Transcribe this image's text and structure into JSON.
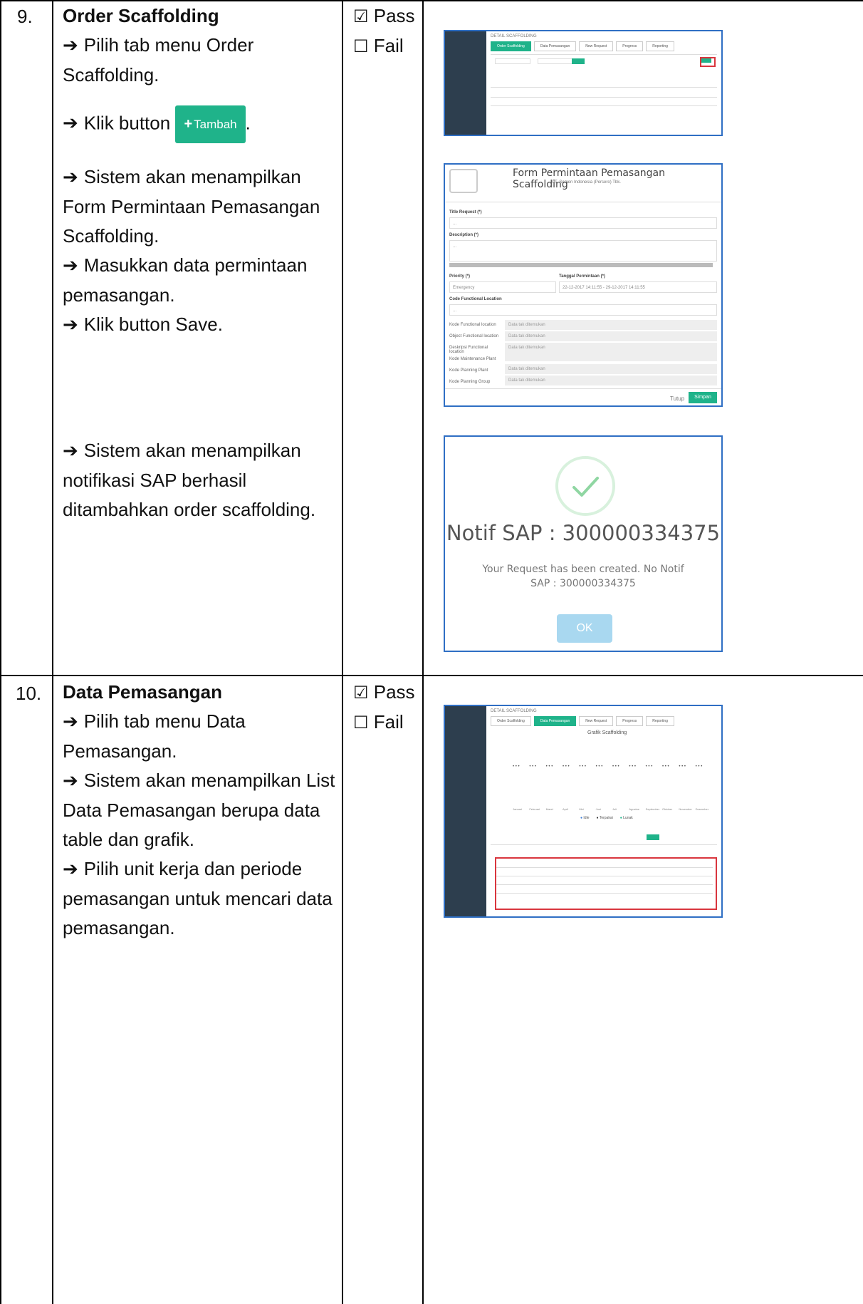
{
  "rows": [
    {
      "number": "9.",
      "title": "Order Scaffolding",
      "steps_a": [
        "Pilih tab menu Order Scaffolding.",
        "Klik button"
      ],
      "tambah_label": "Tambah",
      "steps_b": [
        "Sistem akan menampilkan Form Permintaan Pemasangan Scaffolding.",
        "Masukkan data permintaan pemasangan.",
        "Klik button Save."
      ],
      "steps_c": [
        "Sistem akan menampilkan notifikasi SAP berhasil ditambahkan order scaffolding."
      ],
      "pass_label": "Pass",
      "fail_label": "Fail"
    },
    {
      "number": "10.",
      "title": "Data Pemasangan",
      "steps": [
        "Pilih tab menu Data Pemasangan.",
        "Sistem akan menampilkan List Data Pemasangan berupa data table dan grafik.",
        "Pilih unit kerja dan periode pemasangan untuk mencari data pemasangan."
      ],
      "pass_label": "Pass",
      "fail_label": "Fail"
    }
  ],
  "shot1": {
    "header": "DETAIL SCAFFOLDING",
    "tabs": [
      "Order Scaffolding",
      "Data Pemasangan",
      "New Request",
      "Progress",
      "Reporting"
    ]
  },
  "shot2": {
    "title": "Form Permintaan Pemasangan Scaffolding",
    "subtitle": "PT. Semen Indonesia (Persero) Tbk.",
    "title_request_label": "Title Request (*)",
    "description_label": "Description (*)",
    "priority_label": "Priority (*)",
    "priority_value": "Emergency",
    "tanggal_label": "Tanggal Permintaan (*)",
    "tanggal_value": "22-12-2017 14:11:55 - 29-12-2017 14:11:55",
    "code_label": "Code Functional Location",
    "placeholder": "...",
    "info_rows": [
      {
        "label": "Kode Functional location",
        "value": "Data tak ditemukan"
      },
      {
        "label": "Object Functional location",
        "value": "Data tak ditemukan"
      },
      {
        "label": "Deskripsi Functional location",
        "value": "Data tak ditemukan"
      },
      {
        "label": "Kode Maintenance Plant",
        "value": ""
      },
      {
        "label": "Kode Planning Plant",
        "value": "Data tak ditemukan"
      },
      {
        "label": "Kode Planning Group",
        "value": "Data tak ditemukan"
      }
    ],
    "tutup": "Tutup",
    "simpan": "Simpan"
  },
  "shot3": {
    "title": "Notif SAP : 300000334375",
    "message": "Your Request has been created. No Notif SAP : 300000334375",
    "ok": "OK"
  },
  "shot4": {
    "header": "DETAIL SCAFFOLDING",
    "tabs": [
      "Order Scaffolding",
      "Data Pemasangan",
      "New Request",
      "Progress",
      "Reporting"
    ],
    "chart_title": "Grafik Scaffolding",
    "months": [
      "Januari",
      "Februari",
      "Maret",
      "April",
      "Mei",
      "Juni",
      "Juli",
      "Agustus",
      "September",
      "Oktober",
      "November",
      "Desember"
    ],
    "legend": [
      "Idle",
      "Terpakai",
      "Lunak"
    ]
  },
  "colors": {
    "accent": "#1fb38a",
    "border_blue": "#2f6fc4",
    "sidebar": "#2d3e4e",
    "check_green": "#8fd6a2"
  }
}
